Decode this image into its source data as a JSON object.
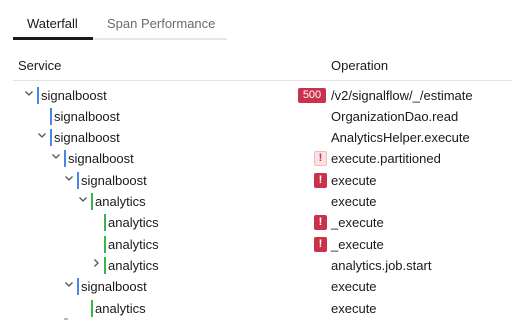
{
  "tabs": [
    {
      "label": "Waterfall",
      "active": true
    },
    {
      "label": "Span Performance",
      "active": false
    }
  ],
  "columns": {
    "service": "Service",
    "operation": "Operation"
  },
  "colors": {
    "error_badge": "#c9324a",
    "signalboost_bar": "#4a86e8",
    "analytics_bar": "#39b54a"
  },
  "rows": [
    {
      "service": "signalboost",
      "operation": "/v2/signalflow/_/estimate",
      "badge": "500",
      "expanded": true
    },
    {
      "service": "signalboost",
      "operation": "OrganizationDao.read",
      "badge": ""
    },
    {
      "service": "signalboost",
      "operation": "AnalyticsHelper.execute",
      "badge": "",
      "expanded": true
    },
    {
      "service": "signalboost",
      "operation": "execute.partitioned",
      "badge": "!",
      "expanded": true
    },
    {
      "service": "signalboost",
      "operation": "execute",
      "badge": "!",
      "expanded": true
    },
    {
      "service": "analytics",
      "operation": "execute",
      "badge": "",
      "expanded": true
    },
    {
      "service": "analytics",
      "operation": "_execute",
      "badge": "!"
    },
    {
      "service": "analytics",
      "operation": "_execute",
      "badge": "!"
    },
    {
      "service": "analytics",
      "operation": "analytics.job.start",
      "badge": "",
      "expanded": false
    },
    {
      "service": "signalboost",
      "operation": "execute",
      "badge": "",
      "expanded": true
    },
    {
      "service": "analytics",
      "operation": "execute",
      "badge": ""
    }
  ]
}
